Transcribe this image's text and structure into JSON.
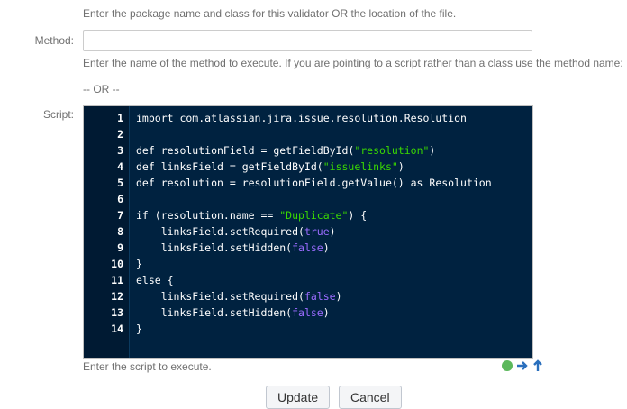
{
  "class_help": "Enter the package name and class for this validator OR the location of the file.",
  "method": {
    "label": "Method:",
    "value": "",
    "help": "Enter the name of the method to execute. If you are pointing to a script rather than a class use the method name:"
  },
  "or_text": "-- OR --",
  "script": {
    "label": "Script:",
    "help": "Enter the script to execute.",
    "lines": [
      {
        "n": "1",
        "code": "import com.atlassian.jira.issue.resolution.Resolution"
      },
      {
        "n": "2",
        "code": ""
      },
      {
        "n": "3",
        "code": "def resolutionField = getFieldById(\"resolution\")"
      },
      {
        "n": "4",
        "code": "def linksField = getFieldById(\"issuelinks\")"
      },
      {
        "n": "5",
        "code": "def resolution = resolutionField.getValue() as Resolution"
      },
      {
        "n": "6",
        "code": ""
      },
      {
        "n": "7",
        "code": "if (resolution.name == \"Duplicate\") {"
      },
      {
        "n": "8",
        "code": "    linksField.setRequired(true)"
      },
      {
        "n": "9",
        "code": "    linksField.setHidden(false)"
      },
      {
        "n": "10",
        "code": "}"
      },
      {
        "n": "11",
        "code": "else {"
      },
      {
        "n": "12",
        "code": "    linksField.setRequired(false)"
      },
      {
        "n": "13",
        "code": "    linksField.setHidden(false)"
      },
      {
        "n": "14",
        "code": "}"
      }
    ]
  },
  "icons": {
    "status": "green-dot-icon",
    "expand": "arrow-right-icon",
    "upload": "arrow-up-icon"
  },
  "buttons": {
    "update": "Update",
    "cancel": "Cancel"
  },
  "colors": {
    "editor_bg": "#002240",
    "string": "#3ad900",
    "boolean": "#9b6cff",
    "status_green": "#5cb85c",
    "arrow_blue": "#2a6fbd"
  }
}
